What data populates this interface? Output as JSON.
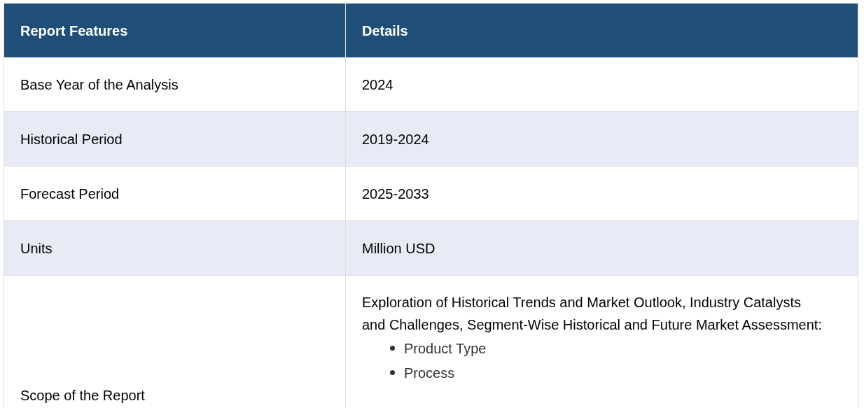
{
  "table": {
    "columns": [
      "Report Features",
      "Details"
    ],
    "rows": [
      {
        "feature": "Base Year of the Analysis",
        "details": "2024"
      },
      {
        "feature": "Historical Period",
        "details": "2019-2024"
      },
      {
        "feature": "Forecast Period",
        "details": "2025-2033"
      },
      {
        "feature": "Units",
        "details": "Million USD"
      },
      {
        "feature": "Scope of the Report",
        "details": "Exploration of Historical Trends and Market Outlook, Industry Catalysts and Challenges, Segment-Wise Historical and Future Market Assessment:",
        "bullets": [
          "Product Type",
          "Process"
        ]
      }
    ]
  }
}
